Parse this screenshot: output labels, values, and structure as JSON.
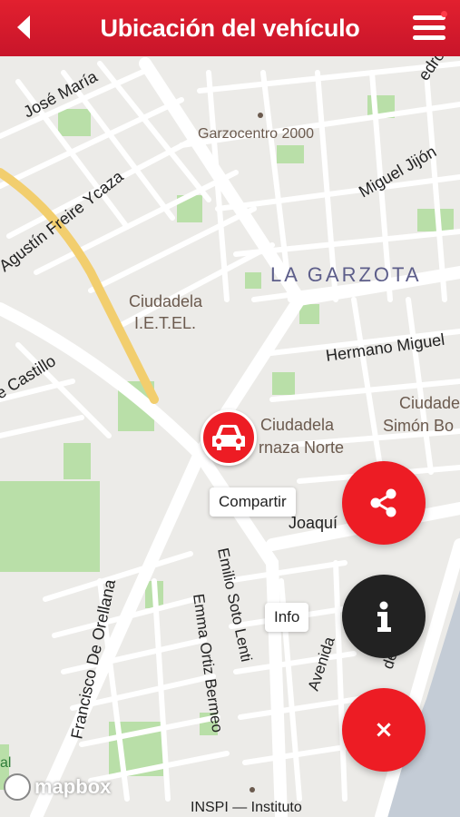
{
  "header": {
    "title": "Ubicación del vehículo",
    "background": "#d71a2b"
  },
  "map": {
    "labels": {
      "jose_maria": "José María",
      "pedro": "edro",
      "garzocentro": "Garzocentro 2000",
      "miguel_jijon": "Miguel Jijón",
      "agustin": "Agustín Freire Ycaza",
      "la_garzota": "LA GARZOTA",
      "ciudadela": "Ciudadela",
      "ietel": "I.E.T.EL.",
      "hermano_miguel": "Hermano Miguel",
      "castillo": "e Castillo",
      "ciudadela_simon_1": "Ciudade",
      "ciudadela_simon_2": "Simón Bo",
      "ciudadela_narnaza_1": "Ciudadela",
      "ciudadela_narnaza_2": "rnaza Norte",
      "joaquin": "Joaquí",
      "emilio": "Emilio Soto Lenti",
      "francisco": "Francisco De Orellana",
      "emma": "Emma Ortiz Bermeo",
      "avenida": "Avenida",
      "de_las_am": "de las Am",
      "inspi": "INSPI — Instituto",
      "left_edge": "al"
    },
    "attribution": "mapbox"
  },
  "actions": {
    "share_label": "Compartir",
    "info_label": "Info",
    "close_symbol": "×"
  },
  "colors": {
    "accent_red": "#ed1c24",
    "info_dark": "#222222"
  }
}
